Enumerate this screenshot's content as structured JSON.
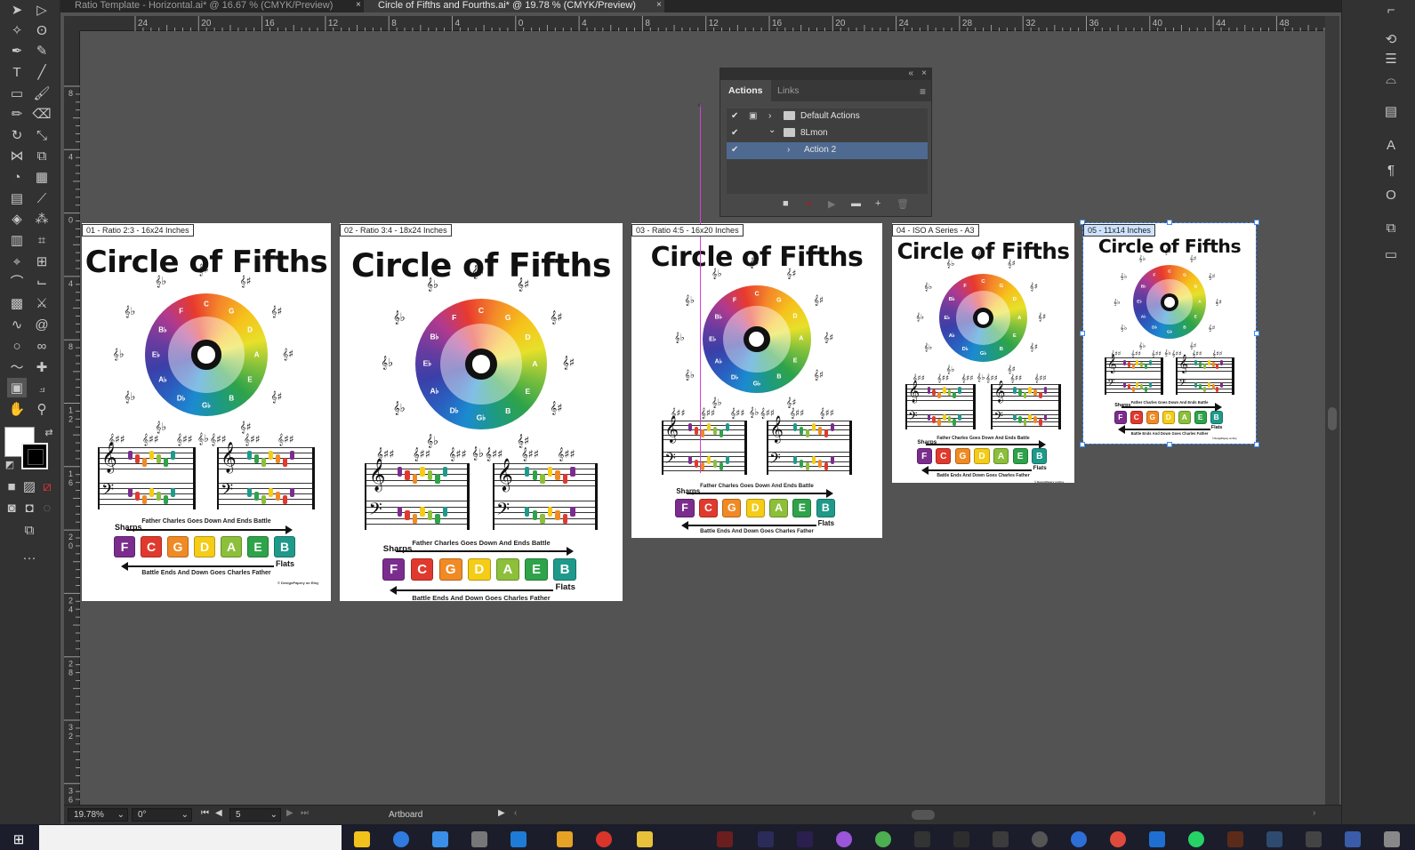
{
  "tabs": [
    {
      "label": "Ratio Template - Horizontal.ai* @ 16.67 % (CMYK/Preview)",
      "close": "×"
    },
    {
      "label": "Circle of Fifths and Fourths.ai* @ 19.78 % (CMYK/Preview)",
      "close": "×"
    }
  ],
  "ruler": {
    "h_labels": [
      "24",
      "20",
      "16",
      "12",
      "8",
      "4",
      "0",
      "4",
      "8",
      "12",
      "16",
      "20",
      "24",
      "28",
      "32",
      "36",
      "40",
      "44",
      "48"
    ],
    "v_labels": [
      "8",
      "4",
      "0",
      "4",
      "8",
      "1\n2",
      "1\n6",
      "2\n0",
      "2\n4",
      "2\n8",
      "3\n2",
      "3\n6"
    ]
  },
  "actions_panel": {
    "collapse": "«",
    "close": "×",
    "tabs": [
      "Actions",
      "Links"
    ],
    "menu": "≡",
    "rows": [
      {
        "name": "Default Actions",
        "check": "✔",
        "dialog": "▣",
        "expander": "›"
      },
      {
        "name": "8Lmon",
        "check": "✔",
        "dialog": "",
        "expander": "⌄"
      },
      {
        "name": "Action 2",
        "check": "✔",
        "dialog": "",
        "expander": "›"
      }
    ],
    "footer": [
      "■",
      "●",
      "▶",
      "▬",
      "+",
      "🗑"
    ]
  },
  "artboards": [
    {
      "label": "01 - Ratio 2:3 - 16x24 Inches"
    },
    {
      "label": "02 - Ratio 3:4 - 18x24 Inches"
    },
    {
      "label": "03 - Ratio 4:5 - 16x20 Inches"
    },
    {
      "label": "04 - ISO A Series - A3"
    },
    {
      "label": "05 - 11x14 Inches"
    }
  ],
  "poster": {
    "title": "Circle of Fifths",
    "wheel_labels": [
      "C",
      "G",
      "D",
      "A",
      "E",
      "B",
      "G♭",
      "D♭",
      "A♭",
      "E♭",
      "B♭",
      "F"
    ],
    "caption_top": "Father Charles Goes Down And Ends Battle",
    "sharps": "Sharps",
    "flats": "Flats",
    "caption_bottom": "Battle Ends And Down Goes Charles Father",
    "keys": [
      "F",
      "C",
      "G",
      "D",
      "A",
      "E",
      "B"
    ],
    "key_colors": [
      "#7b2d8e",
      "#e03a2f",
      "#f08a24",
      "#f5cc16",
      "#8cbf3a",
      "#2ea34a",
      "#1f9a8a"
    ],
    "credit": "© DesignPapery on Etsy"
  },
  "status": {
    "zoom": "19.78%",
    "rotation": "0°",
    "artboard_num": "5",
    "artboard_label": "Artboard"
  },
  "colors": {
    "selection": "#3d8bfd",
    "guide": "#d43fd4",
    "panel_bg": "#484848",
    "ui_dark": "#323232"
  }
}
